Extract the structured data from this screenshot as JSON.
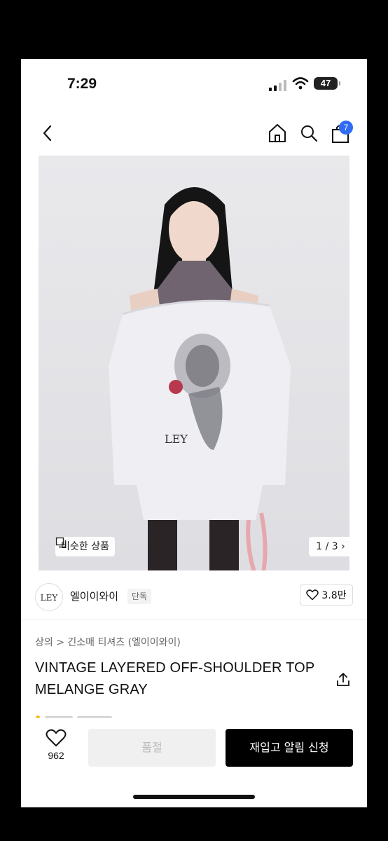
{
  "status_bar": {
    "time": "7:29",
    "battery": "47"
  },
  "header": {
    "cart_count": "7"
  },
  "gallery": {
    "similar_label": "비슷한 상품",
    "pager": "1 / 3 ›"
  },
  "brand": {
    "logo_text": "LEY",
    "name": "엘이이와이",
    "tag": "단독",
    "likes": "3.8만"
  },
  "product": {
    "breadcrumb": "상의  >  긴소매 티셔츠 (엘이이와이)",
    "title": "VINTAGE LAYERED OFF-SHOULDER TOP MELANGE GRAY"
  },
  "bottom_bar": {
    "wish_count": "962",
    "soldout_label": "품절",
    "restock_label": "재입고 알림 신청"
  },
  "colors": {
    "accent": "#2f6bf5",
    "primary_button": "#000000",
    "disabled_button": "#f0f0f0"
  }
}
